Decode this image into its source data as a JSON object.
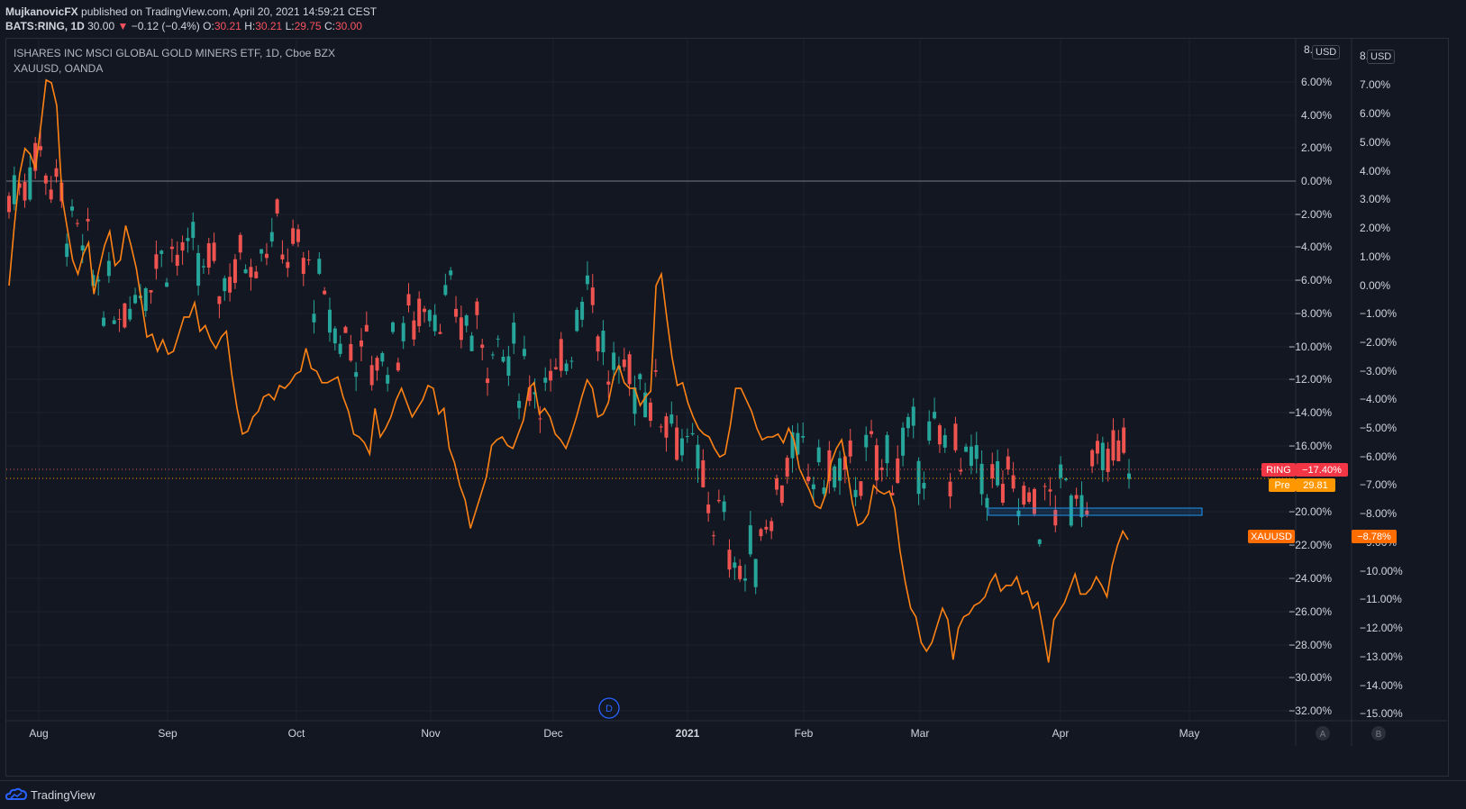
{
  "header": {
    "publisher": "MujkanovicFX",
    "published_text": "published on TradingView.com, April 20, 2021 14:59:21 CEST",
    "symbol": "BATS:RING, 1D",
    "last": "30.00",
    "change_arrow": "▼",
    "change": "−0.12 (−0.4%)",
    "o_label": "O:",
    "o": "30.21",
    "h_label": "H:",
    "h": "30.21",
    "l_label": "L:",
    "l": "29.75",
    "c_label": "C:",
    "c": "30.00"
  },
  "legend": {
    "main": "ISHARES INC MSCI GLOBAL GOLD MINERS ETF, 1D, Cboe BZX",
    "compare": "XAUUSD, OANDA"
  },
  "scales": {
    "left_currency": "USD",
    "right_currency": "USD",
    "left_top_label": "8.",
    "right_top_label": "8.",
    "scale_a": "A",
    "scale_b": "B"
  },
  "badges": {
    "ring_label": "RING",
    "ring_value": "−17.40%",
    "pre_label": "Pre",
    "pre_value": "29.81",
    "xau_label": "XAUUSD",
    "xau_value": "−8.78%"
  },
  "marker": {
    "label": "D"
  },
  "footer": {
    "brand": "TradingView"
  },
  "colors": {
    "background": "#131722",
    "up": "#26a69a",
    "down": "#ef5350",
    "xau_line": "#ff8214",
    "box": "#2196f3",
    "grid": "#1e222d"
  },
  "chart_data": {
    "type": "line",
    "title": "ISHARES INC MSCI GLOBAL GOLD MINERS ETF, 1D, Cboe BZX",
    "x_ticks": [
      "Aug",
      "Sep",
      "Oct",
      "Nov",
      "Dec",
      "2021",
      "Feb",
      "Mar",
      "Apr",
      "May"
    ],
    "left_axis_ticks": [
      "6.00%",
      "4.00%",
      "2.00%",
      "0.00%",
      "−2.00%",
      "−4.00%",
      "−6.00%",
      "−8.00%",
      "−10.00%",
      "−12.00%",
      "−14.00%",
      "−16.00%",
      "−20.00%",
      "−22.00%",
      "−24.00%",
      "−26.00%",
      "−28.00%",
      "−30.00%",
      "−32.00%"
    ],
    "right_axis_ticks": [
      "7.00%",
      "6.00%",
      "5.00%",
      "4.00%",
      "3.00%",
      "2.00%",
      "1.00%",
      "0.00%",
      "−1.00%",
      "−2.00%",
      "−3.00%",
      "−4.00%",
      "−5.00%",
      "−6.00%",
      "−7.00%",
      "−8.00%",
      "−9.00%",
      "−10.00%",
      "−11.00%",
      "−12.00%",
      "−13.00%",
      "−14.00%",
      "−15.00%"
    ],
    "series": [
      {
        "name": "XAUUSD",
        "values": [
          -0.0,
          2.1,
          3.9,
          4.8,
          4.6,
          4.1,
          5.6,
          7.2,
          7.1,
          6.3,
          3.1,
          2.0,
          0.9,
          0.4,
          1.1,
          1.5,
          -0.3,
          0.6,
          1.4,
          1.9,
          0.7,
          0.9,
          2.1,
          1.4,
          0.6,
          -0.6,
          -1.8,
          -1.7,
          -2.3,
          -1.9,
          -2.4,
          -2.3,
          -1.7,
          -1.1,
          -1.1,
          -0.6,
          -1.6,
          -1.4,
          -1.9,
          -2.2,
          -1.8,
          -1.6,
          -3.1,
          -4.3,
          -5.2,
          -5.1,
          -4.6,
          -4.4,
          -3.9,
          -3.8,
          -4.0,
          -3.5,
          -3.6,
          -3.4,
          -3.1,
          -3.0,
          -2.2,
          -2.9,
          -3.0,
          -3.4,
          -3.4,
          -3.3,
          -3.2,
          -3.9,
          -4.4,
          -5.2,
          -5.3,
          -5.5,
          -5.9,
          -4.3,
          -5.3,
          -5.0,
          -4.6,
          -4.0,
          -3.6,
          -4.1,
          -4.6,
          -4.3,
          -4.0,
          -3.5,
          -3.6,
          -4.5,
          -4.3,
          -5.7,
          -6.2,
          -7.0,
          -7.5,
          -8.5,
          -7.9,
          -7.3,
          -6.7,
          -5.6,
          -5.4,
          -5.3,
          -5.6,
          -5.7,
          -5.2,
          -4.7,
          -3.6,
          -3.4,
          -4.5,
          -4.3,
          -4.6,
          -5.2,
          -5.4,
          -5.7,
          -5.2,
          -4.6,
          -3.9,
          -3.3,
          -3.6,
          -4.6,
          -4.5,
          -4.1,
          -3.2,
          -2.8,
          -3.4,
          -3.6,
          -3.6,
          -4.2,
          -3.9,
          -3.7,
          0.0,
          0.4,
          -1.1,
          -2.5,
          -3.5,
          -3.4,
          -4.1,
          -4.6,
          -5.0,
          -5.2,
          -5.3,
          -5.7,
          -6.0,
          -5.9,
          -4.9,
          -3.6,
          -3.6,
          -4.0,
          -4.4,
          -5.0,
          -5.4,
          -5.3,
          -5.3,
          -5.2,
          -5.5,
          -5.0,
          -5.4,
          -6.4,
          -6.8,
          -7.2,
          -7.7,
          -7.8,
          -7.3,
          -6.2,
          -5.7,
          -5.4,
          -6.4,
          -7.6,
          -8.4,
          -8.3,
          -8.0,
          -7.0,
          -7.2,
          -7.3,
          -7.2,
          -7.8,
          -9.3,
          -10.4,
          -11.3,
          -11.6,
          -12.5,
          -12.8,
          -12.5,
          -11.9,
          -11.3,
          -11.7,
          -13.1,
          -12.0,
          -11.6,
          -11.5,
          -11.2,
          -11.1,
          -10.9,
          -10.4,
          -10.1,
          -10.7,
          -10.5,
          -10.5,
          -10.2,
          -10.8,
          -10.7,
          -11.3,
          -11.1,
          -12.1,
          -13.2,
          -11.7,
          -11.4,
          -11.1,
          -10.6,
          -10.1,
          -10.8,
          -10.8,
          -10.6,
          -10.2,
          -10.5,
          -10.9,
          -9.8,
          -9.1,
          -8.6,
          -8.9
        ]
      }
    ]
  }
}
